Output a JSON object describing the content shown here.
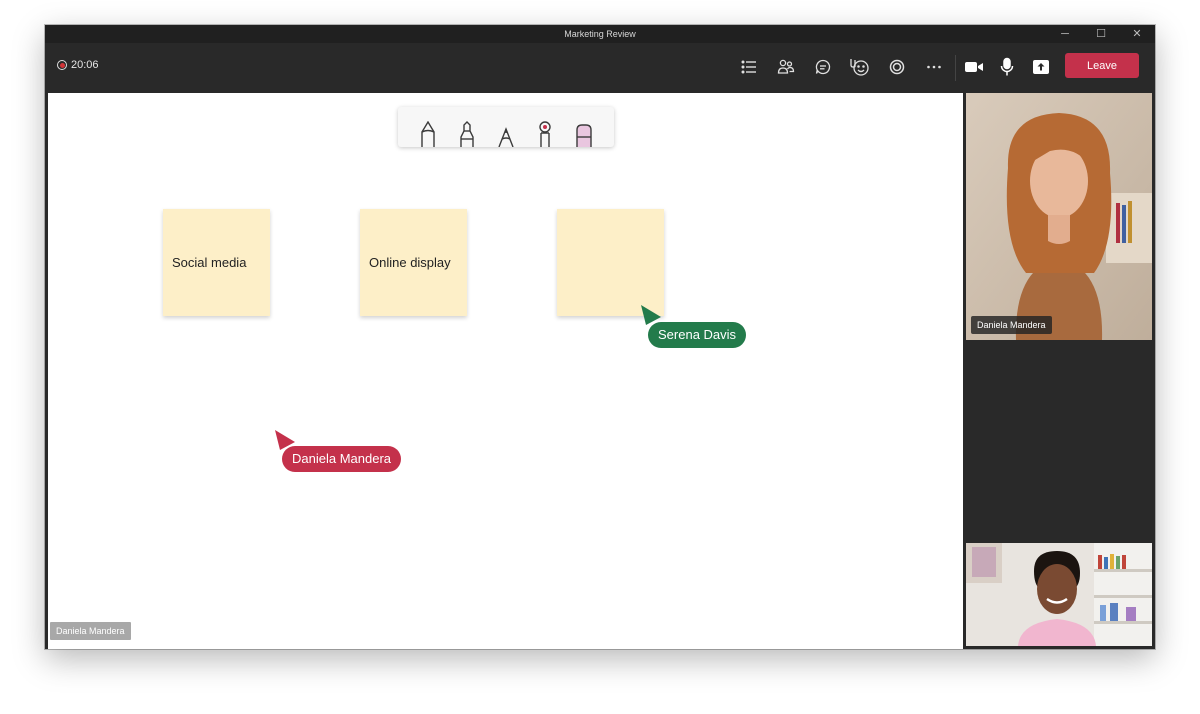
{
  "window": {
    "title": "Marketing Review",
    "controls": [
      "─",
      "☐",
      "✕"
    ]
  },
  "toolbar": {
    "timer": "20:06",
    "leave_label": "Leave",
    "buttons": [
      "list-icon",
      "people-icon",
      "chat-icon",
      "reactions-icon",
      "live-share-icon",
      "more-icon",
      "camera-icon",
      "mic-icon",
      "share-screen-icon"
    ],
    "accent": "#c4314b"
  },
  "whiteboard": {
    "ink_tools": [
      "pen-icon",
      "marker-icon",
      "pencil-icon",
      "laser-pointer-icon",
      "eraser-icon"
    ],
    "notes": [
      "Social media",
      "Online display",
      ""
    ],
    "note_color": "#fdefc8",
    "cursors": [
      {
        "name": "Serena Davis",
        "color": "#237b4b"
      },
      {
        "name": "Daniela Mandera",
        "color": "#c4314b"
      }
    ],
    "presenter_tag": "Daniela Mandera"
  },
  "participants": [
    {
      "name": "Daniela Mandera"
    },
    {
      "name": ""
    }
  ]
}
